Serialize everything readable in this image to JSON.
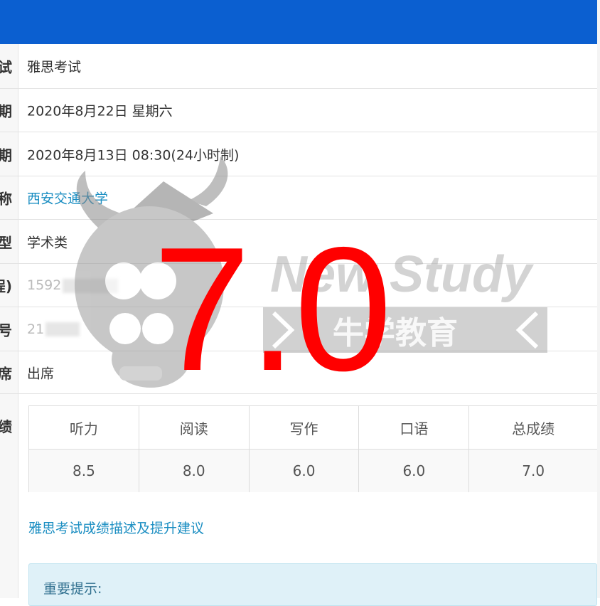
{
  "rows": [
    {
      "label": "试",
      "value": "雅思考试"
    },
    {
      "label": "期",
      "value": "2020年8月22日 星期六"
    },
    {
      "label": "期",
      "value": "2020年8月13日 08:30(24小时制)"
    },
    {
      "label": "称",
      "value": "西安交通大学"
    },
    {
      "label": "型",
      "value": "学术类"
    },
    {
      "label": "程)",
      "value": "1592"
    },
    {
      "label": "号",
      "value": "21"
    },
    {
      "label": "席",
      "value": "出席"
    },
    {
      "label": "绩",
      "value": ""
    }
  ],
  "scores": {
    "headers": [
      "听力",
      "阅读",
      "写作",
      "口语",
      "总成绩"
    ],
    "values": [
      "8.5",
      "8.0",
      "6.0",
      "6.0",
      "7.0"
    ]
  },
  "desc_link": "雅思考试成绩描述及提升建议",
  "notice_title": "重要提示:",
  "overlay": {
    "score": "7.0",
    "brand_en": "New Study",
    "brand_cn": "牛学教育"
  },
  "colors": {
    "header_blue": "#0b5fd0",
    "link_blue": "#1b8ec2",
    "overlay_red": "#ff0000"
  }
}
